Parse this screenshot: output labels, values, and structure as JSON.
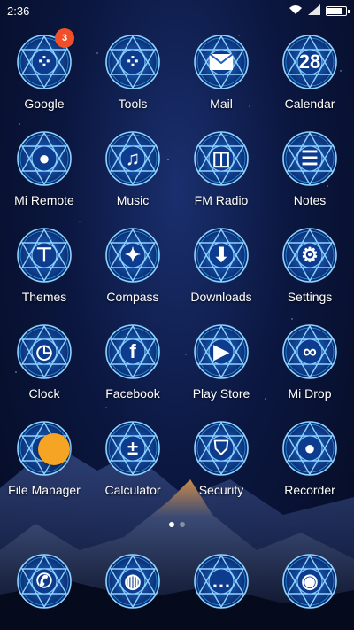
{
  "status": {
    "time": "2:36",
    "battery_level": 0.92
  },
  "apps": [
    {
      "label": "Google",
      "icon": "google-folder-icon",
      "badge": "3"
    },
    {
      "label": "Tools",
      "icon": "tools-folder-icon"
    },
    {
      "label": "Mail",
      "icon": "mail-icon"
    },
    {
      "label": "Calendar",
      "icon": "calendar-icon",
      "glyph": "28"
    },
    {
      "label": "Mi Remote",
      "icon": "remote-icon"
    },
    {
      "label": "Music",
      "icon": "music-icon"
    },
    {
      "label": "FM Radio",
      "icon": "radio-icon"
    },
    {
      "label": "Notes",
      "icon": "notes-icon"
    },
    {
      "label": "Themes",
      "icon": "tshirt-icon"
    },
    {
      "label": "Compass",
      "icon": "compass-icon"
    },
    {
      "label": "Downloads",
      "icon": "download-icon"
    },
    {
      "label": "Settings",
      "icon": "gear-icon"
    },
    {
      "label": "Clock",
      "icon": "clock-icon"
    },
    {
      "label": "Facebook",
      "icon": "facebook-icon",
      "glyph": "f"
    },
    {
      "label": "Play Store",
      "icon": "play-store-icon"
    },
    {
      "label": "Mi Drop",
      "icon": "infinity-icon"
    },
    {
      "label": "File Manager",
      "icon": "folder-icon"
    },
    {
      "label": "Calculator",
      "icon": "calculator-icon"
    },
    {
      "label": "Security",
      "icon": "shield-icon"
    },
    {
      "label": "Recorder",
      "icon": "microphone-icon"
    }
  ],
  "dock": [
    {
      "icon": "phone-icon"
    },
    {
      "icon": "globe-icon"
    },
    {
      "icon": "chat-icon"
    },
    {
      "icon": "camera-icon"
    }
  ],
  "pager": {
    "pages": 2,
    "current": 1
  },
  "colors": {
    "seal": "#8fd2ff",
    "seal_glow": "#2ea7ff",
    "badge": "#f04f2a",
    "fab": "#f5a423"
  }
}
